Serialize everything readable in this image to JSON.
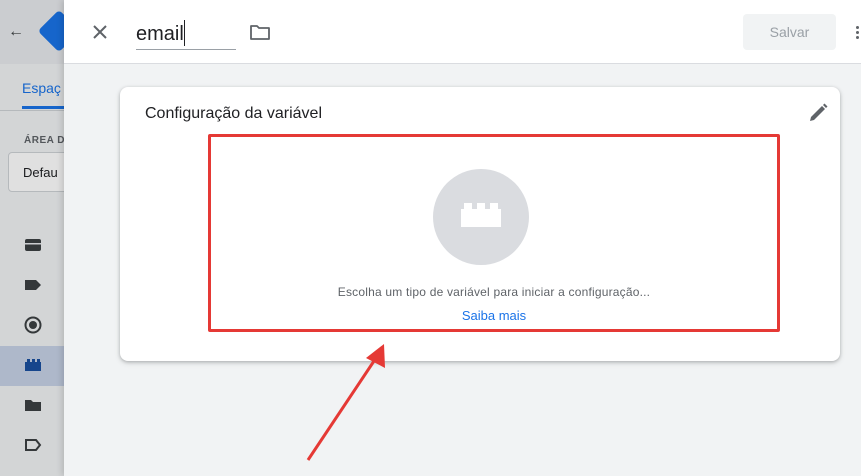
{
  "background": {
    "tab_label": "Espaç",
    "area_label": "ÁREA D",
    "workspace_button": "Defau"
  },
  "header": {
    "name_value": "email",
    "save_label": "Salvar"
  },
  "card": {
    "title": "Configuração da variável",
    "prompt": "Escolha um tipo de variável para iniciar a configuração...",
    "learn_more": "Saiba mais"
  },
  "colors": {
    "accent": "#1a73e8",
    "highlight": "#e53935"
  },
  "icons": {
    "close": "close-icon",
    "folder": "folder-icon",
    "more": "more-vert-icon",
    "edit": "pencil-icon",
    "variable": "lego-block-icon"
  }
}
